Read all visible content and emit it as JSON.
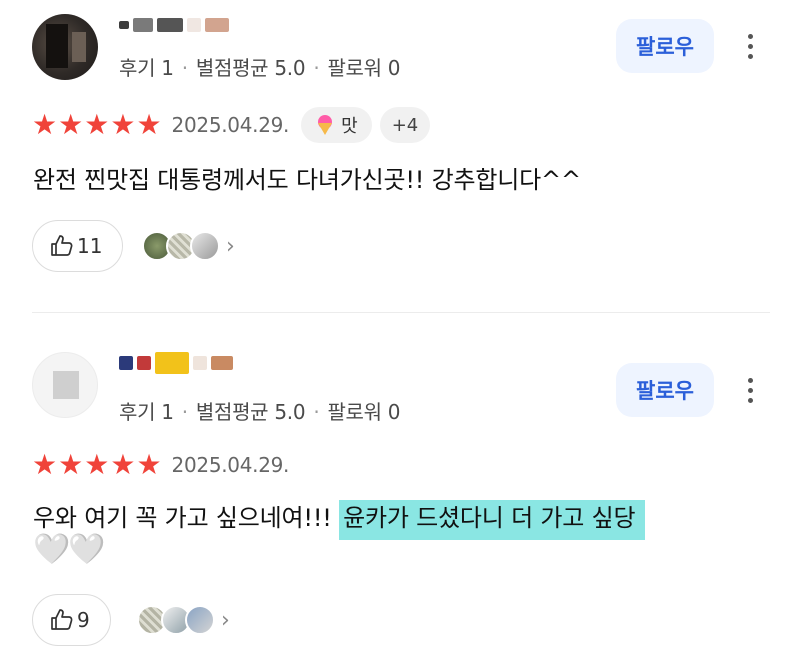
{
  "reviews": [
    {
      "meta": {
        "reviews": "후기 1",
        "avg": "별점평균 5.0",
        "followers": "팔로워 0",
        "separator": "·"
      },
      "follow_label": "팔로우",
      "stars": 5,
      "date": "2025.04.29.",
      "tag_label": "맛",
      "extra_tags": "+4",
      "text": "완전 찐맛집 대통령께서도 다녀가신곳!! 강추합니다^^",
      "likes": "11"
    },
    {
      "meta": {
        "reviews": "후기 1",
        "avg": "별점평균 5.0",
        "followers": "팔로워 0",
        "separator": "·"
      },
      "follow_label": "팔로우",
      "stars": 5,
      "date": "2025.04.29.",
      "text_plain": "우와 여기 꼭 가고 싶으네여!!! ",
      "text_highlight": "윤카가 드셨다니 더 가고 싶당",
      "hearts": "🤍🤍",
      "likes": "9"
    }
  ],
  "colors": {
    "star": "#f0433a",
    "follow_bg": "#eef4ff",
    "follow_text": "#2b5fd9",
    "highlight": "#8ae6e3"
  },
  "icons": [
    "star-icon",
    "icecream-icon",
    "thumbs-up-icon",
    "more-icon",
    "chevron-right-icon"
  ]
}
